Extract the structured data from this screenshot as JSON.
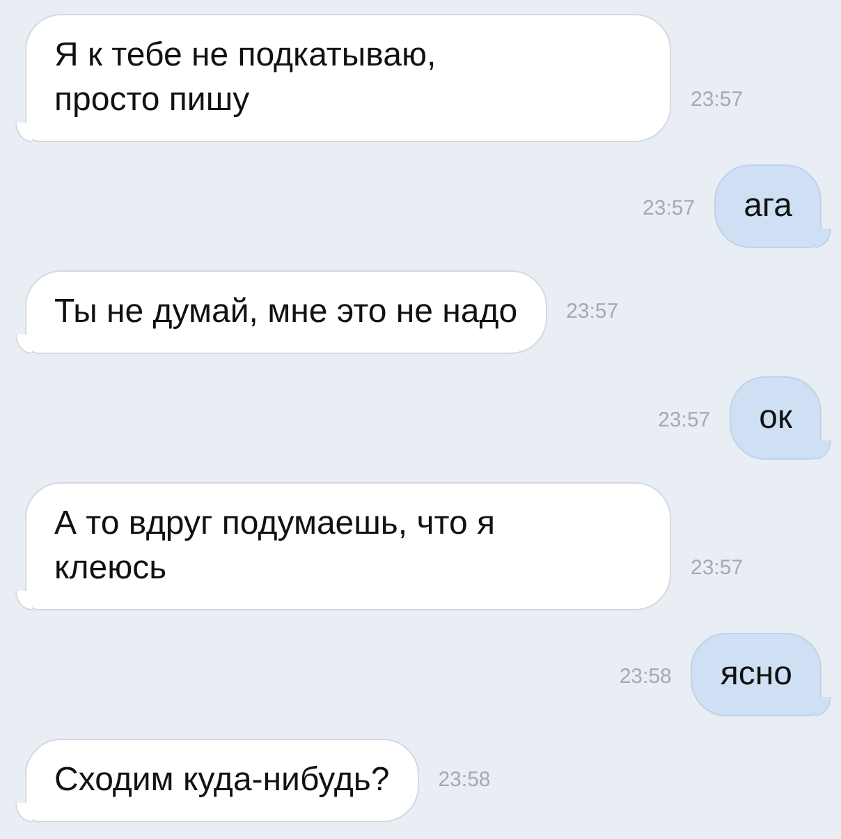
{
  "messages": [
    {
      "kind": "incoming",
      "text": "Я к тебе не подкатываю,\nпросто пишу",
      "time": "23:57"
    },
    {
      "kind": "outgoing",
      "text": "ага",
      "time": "23:57"
    },
    {
      "kind": "incoming",
      "text": "Ты не думай, мне это не надо",
      "time": "23:57"
    },
    {
      "kind": "outgoing",
      "text": "ок",
      "time": "23:57"
    },
    {
      "kind": "incoming",
      "text": "А то вдруг подумаешь, что я\nклеюсь",
      "time": "23:57"
    },
    {
      "kind": "outgoing",
      "text": "ясно",
      "time": "23:58"
    },
    {
      "kind": "incoming",
      "text": "Сходим куда-нибудь?",
      "time": "23:58"
    }
  ]
}
